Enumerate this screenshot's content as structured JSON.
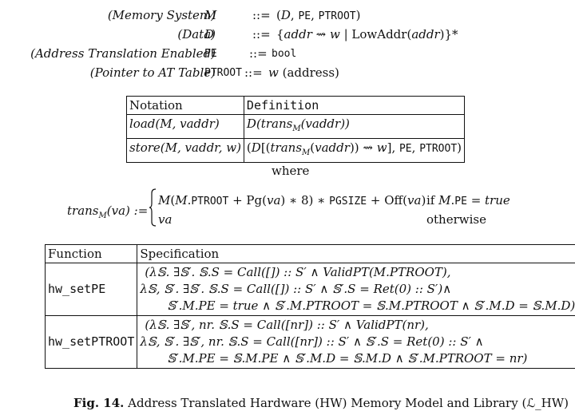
{
  "grammar": [
    {
      "label": "(Memory System)",
      "symbol": "M",
      "op": "::=",
      "def": "(D, PE, PTROOT)"
    },
    {
      "label": "(Data)",
      "symbol": "D",
      "op": "::=",
      "def": "{addr ⇝ w | LowAddr(addr)}*"
    },
    {
      "label": "(Address Translation Enabled)",
      "symbol": "PE",
      "op": "::=",
      "def": "bool"
    },
    {
      "label": "(Pointer to AT Table)",
      "symbol": "PTROOT",
      "op": "::=",
      "def": "w (address)"
    }
  ],
  "table1": {
    "headers": [
      "Notation",
      "Definition"
    ],
    "rows": [
      [
        "load(M, vaddr)",
        "D(trans_M(vaddr))"
      ],
      [
        "store(M, vaddr, w)",
        "(D[(trans_M(vaddr)) ⇝ w], PE, PTROOT)"
      ]
    ]
  },
  "where_text": "where",
  "trans": {
    "lhs": "trans_M(va) :=",
    "case1_expr": "M(M.PTROOT + Pg(va) * 8) * PGSIZE + Off(va)",
    "case1_cond": "if M.PE = true",
    "case2_expr": "va",
    "case2_cond": "otherwise"
  },
  "table2": {
    "headers": [
      "Function",
      "Specification"
    ],
    "rows": [
      {
        "function": "hw_setPE",
        "spec": [
          "(λ𝕊. ∃𝕊′. 𝕊.S = Call([]) :: S′ ∧ ValidPT(M.PTROOT),",
          "λ𝕊, 𝕊′. ∃𝕊′. 𝕊.S = Call([]) :: S′ ∧ 𝕊′.S = Ret(0) :: S′)∧",
          "𝕊′.M.PE = true ∧ 𝕊′.M.PTROOT = 𝕊.M.PTROOT ∧ 𝕊′.M.D = 𝕊.M.D)"
        ]
      },
      {
        "function": "hw_setPTROOT",
        "spec": [
          "(λ𝕊. ∃𝕊′, nr. 𝕊.S = Call([nr]) :: S′ ∧ ValidPT(nr),",
          "λ𝕊, 𝕊′. ∃𝕊′, nr. 𝕊.S = Call([nr]) :: S′ ∧ 𝕊′.S = Ret(0) :: S′ ∧",
          "𝕊′.M.PE = 𝕊.M.PE ∧ 𝕊′.M.D = 𝕊.M.D ∧ 𝕊′.M.PTROOT = nr)"
        ]
      }
    ]
  },
  "caption": {
    "label": "Fig. 14.",
    "text": "Address Translated Hardware (HW) Memory Model and Library (ℒ_HW)"
  }
}
